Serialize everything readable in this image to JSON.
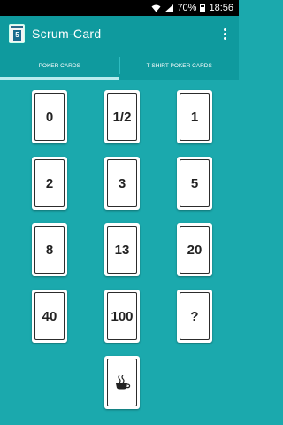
{
  "status": {
    "battery": "70%",
    "time": "18:56"
  },
  "app": {
    "title": "Scrum-Card",
    "logo_digit": "5"
  },
  "tabs": [
    {
      "label": "Poker cards",
      "active": true
    },
    {
      "label": "T-shirt poker cards",
      "active": false
    }
  ],
  "cards": [
    "0",
    "1/2",
    "1",
    "2",
    "3",
    "5",
    "8",
    "13",
    "20",
    "40",
    "100",
    "?"
  ],
  "coffee_card": {
    "icon": "coffee-cup-icon"
  },
  "colors": {
    "background": "#1ba9ad",
    "app_bar": "#0f9a9e",
    "tab_indicator": "#b8ecee"
  }
}
